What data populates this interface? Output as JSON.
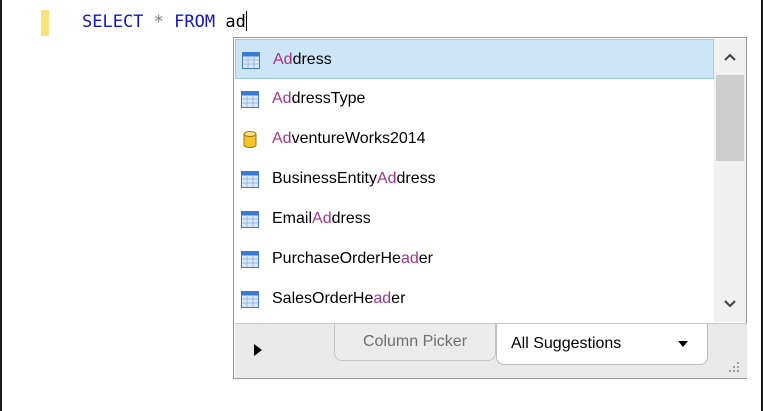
{
  "editor": {
    "keyword_select": "SELECT",
    "operator_star": "*",
    "keyword_from": "FROM",
    "typed_text": "ad"
  },
  "autocomplete": {
    "items": [
      {
        "icon": "table-icon",
        "prefix": "",
        "match": "Ad",
        "suffix": "dress",
        "selected": true
      },
      {
        "icon": "table-icon",
        "prefix": "",
        "match": "Ad",
        "suffix": "dressType",
        "selected": false
      },
      {
        "icon": "database-icon",
        "prefix": "",
        "match": "Ad",
        "suffix": "ventureWorks2014",
        "selected": false
      },
      {
        "icon": "table-icon",
        "prefix": "BusinessEntity",
        "match": "Ad",
        "suffix": "dress",
        "selected": false
      },
      {
        "icon": "table-icon",
        "prefix": "Email",
        "match": "Ad",
        "suffix": "dress",
        "selected": false
      },
      {
        "icon": "table-icon",
        "prefix": "PurchaseOrderHe",
        "match": "ad",
        "suffix": "er",
        "selected": false
      },
      {
        "icon": "table-icon",
        "prefix": "SalesOrderHe",
        "match": "ad",
        "suffix": "er",
        "selected": false
      }
    ],
    "tabs": {
      "column_picker": "Column Picker",
      "all_suggestions": "All Suggestions"
    }
  },
  "colors": {
    "keyword": "#1414d0",
    "operator": "#7a7a7a",
    "match_highlight": "#a3358a",
    "selection_bg": "#cde6f7",
    "gutter_marker": "#f9e27a"
  }
}
